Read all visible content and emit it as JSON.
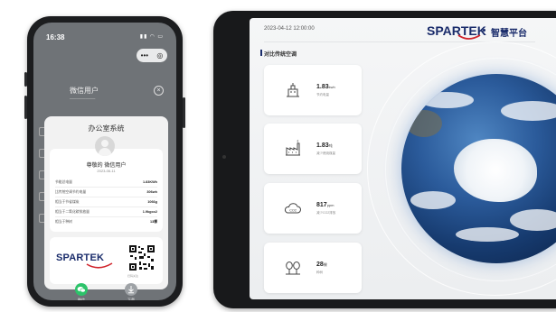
{
  "phone": {
    "status_time": "16:38",
    "user_name": "微信用户",
    "card": {
      "title": "办公室系统",
      "greeting": "尊敬的 微信用户",
      "date": "2023-06-11",
      "rows": [
        {
          "label": "节能总电量",
          "value": "1.83KWh"
        },
        {
          "label": "比传统空调节约电量",
          "value": "306wh"
        },
        {
          "label": "相当于节省煤炭",
          "value": "1066g"
        },
        {
          "label": "相当于二氧化碳排放量",
          "value": "1.9kgco2"
        },
        {
          "label": "相当于种树",
          "value": "13棵"
        }
      ],
      "brand": "SPARTEK",
      "qr_caption": "扫码关注"
    },
    "bottom_left_label": "微信",
    "bottom_right_label": "下载"
  },
  "tablet": {
    "timestamp": "2023-04-12 12:00:00",
    "brand": "SPARTEK",
    "platform_title": "智慧平台",
    "section_title": "对比传统空调",
    "tiles": [
      {
        "value": "1.83",
        "unit": "kwh",
        "label": "节约电量",
        "icon": "power-plant-icon"
      },
      {
        "value": "1.83",
        "unit": "吨",
        "label": "减少燃烧煤量",
        "icon": "factory-icon"
      },
      {
        "value": "817",
        "unit": "ppm",
        "label": "减少CO2排放",
        "icon": "co2-cloud-icon"
      },
      {
        "value": "28",
        "unit": "棵",
        "label": "种树",
        "icon": "trees-icon"
      }
    ]
  },
  "colors": {
    "brand_blue": "#1a2c6b",
    "brand_red": "#d0242b",
    "wechat_green": "#2dc36a"
  }
}
